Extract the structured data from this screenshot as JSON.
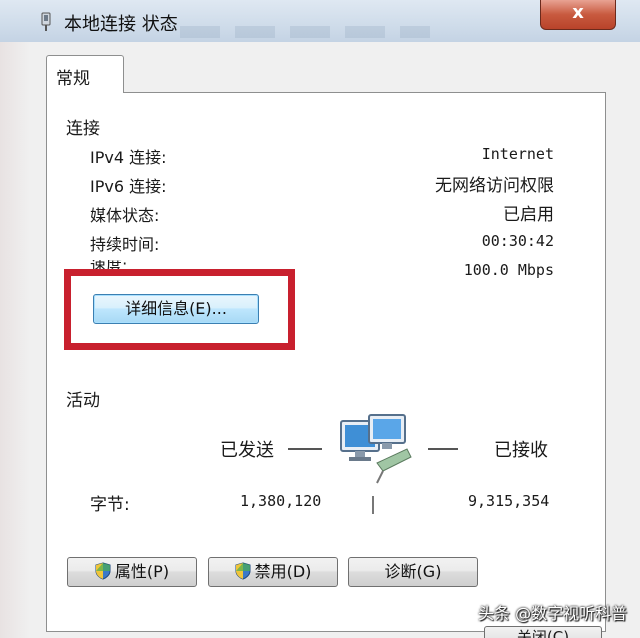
{
  "window": {
    "title": "本地连接 状态",
    "close_glyph": "x"
  },
  "tabs": [
    {
      "label": "常规",
      "selected": true
    }
  ],
  "connection": {
    "group_title": "连接",
    "rows": [
      {
        "label": "IPv4 连接:",
        "value": "Internet"
      },
      {
        "label": "IPv6 连接:",
        "value": "无网络访问权限"
      },
      {
        "label": "媒体状态:",
        "value": "已启用"
      },
      {
        "label": "持续时间:",
        "value": "00:30:42"
      },
      {
        "label": "速度:",
        "value": "100.0 Mbps"
      }
    ],
    "details_button": "详细信息(E)..."
  },
  "activity": {
    "group_title": "活动",
    "sent_label": "已发送",
    "received_label": "已接收",
    "bytes_label": "字节:",
    "bytes_sent": "1,380,120",
    "bytes_received": "9,315,354"
  },
  "buttons": {
    "properties": "属性(P)",
    "disable": "禁用(D)",
    "diagnose": "诊断(G)",
    "close": "关闭(C)"
  },
  "watermark": "头条 @数字视听科普",
  "colors": {
    "highlight": "#c8202e",
    "titlebar": "#cfdcea",
    "close_button": "#c85a3f"
  }
}
